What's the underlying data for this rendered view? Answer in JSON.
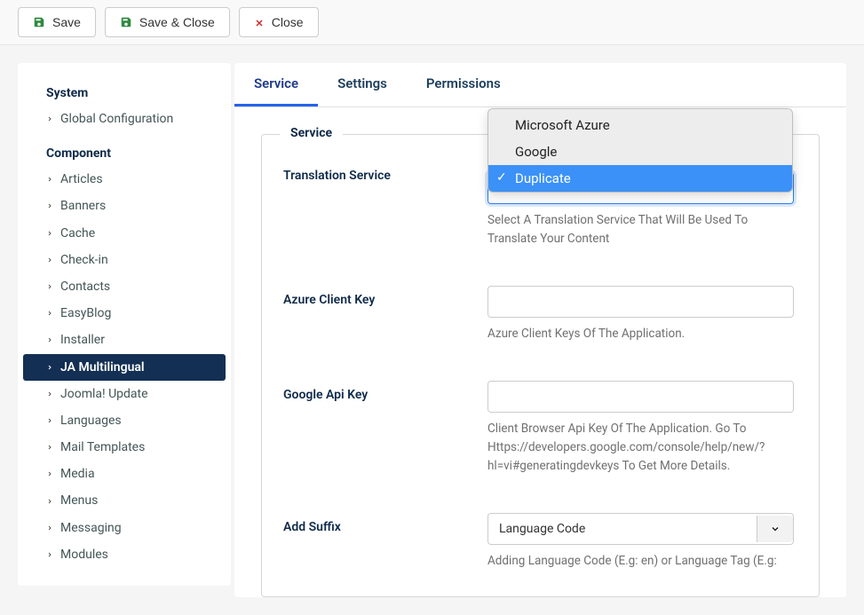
{
  "toolbar": {
    "save": "Save",
    "save_close": "Save & Close",
    "close": "Close"
  },
  "sidebar": {
    "system_header": "System",
    "component_header": "Component",
    "system_items": [
      {
        "label": "Global Configuration"
      }
    ],
    "component_items": [
      {
        "label": "Articles"
      },
      {
        "label": "Banners"
      },
      {
        "label": "Cache"
      },
      {
        "label": "Check-in"
      },
      {
        "label": "Contacts"
      },
      {
        "label": "EasyBlog"
      },
      {
        "label": "Installer"
      },
      {
        "label": "JA Multilingual",
        "active": true
      },
      {
        "label": "Joomla! Update"
      },
      {
        "label": "Languages"
      },
      {
        "label": "Mail Templates"
      },
      {
        "label": "Media"
      },
      {
        "label": "Menus"
      },
      {
        "label": "Messaging"
      },
      {
        "label": "Modules"
      }
    ]
  },
  "tabs": [
    {
      "label": "Service",
      "active": true
    },
    {
      "label": "Settings"
    },
    {
      "label": "Permissions"
    }
  ],
  "fieldset_legend": "Service",
  "fields": {
    "translation_service": {
      "label": "Translation Service",
      "helper": "Select A Translation Service That Will Be Used To Translate Your Content",
      "value": ""
    },
    "azure_key": {
      "label": "Azure Client Key",
      "helper": "Azure Client Keys Of The Application.",
      "value": ""
    },
    "google_key": {
      "label": "Google Api Key",
      "helper": "Client Browser Api Key Of The Application. Go To Https://developers.google.com/console/help/new/?hl=vi#generatingdevkeys To Get More Details.",
      "value": ""
    },
    "add_suffix": {
      "label": "Add Suffix",
      "selected": "Language Code",
      "helper": "Adding Language Code (E.g: en) or Language Tag (E.g:"
    }
  },
  "dropdown": {
    "options": [
      {
        "label": "Microsoft Azure"
      },
      {
        "label": "Google"
      },
      {
        "label": "Duplicate",
        "selected": true
      }
    ]
  }
}
